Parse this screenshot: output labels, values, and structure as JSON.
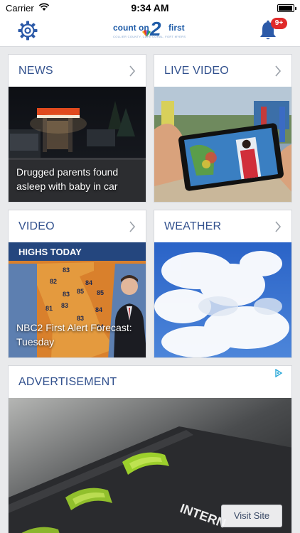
{
  "status_bar": {
    "carrier": "Carrier",
    "time": "9:34 AM"
  },
  "header": {
    "logo": {
      "count_text": "count on",
      "number": "2",
      "first_text": "first",
      "tagline": "COLLIER COUNTY, CAPE CORAL, FORT MYERS"
    },
    "notification_badge": "9+"
  },
  "tiles": {
    "news": {
      "title": "NEWS",
      "caption": "Drugged parents found asleep with baby in car"
    },
    "live_video": {
      "title": "LIVE VIDEO"
    },
    "video": {
      "title": "VIDEO",
      "caption": "NBC2 First Alert Forecast: Tuesday",
      "overlay": {
        "banner": "HIGHS TODAY",
        "temps": [
          "83",
          "82",
          "84",
          "85",
          "85",
          "83",
          "83",
          "81",
          "84",
          "83",
          "84"
        ]
      }
    },
    "weather": {
      "title": "WEATHER"
    }
  },
  "advertisement": {
    "title": "ADVERTISEMENT",
    "visit_label": "Visit Site",
    "product_text": "INTERN"
  },
  "colors": {
    "accent": "#31508d",
    "badge": "#e02a2a",
    "logo_blue": "#1f5ca8"
  }
}
